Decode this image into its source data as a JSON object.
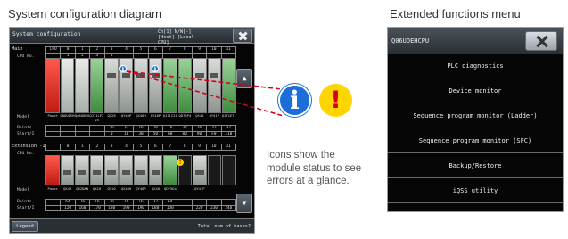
{
  "captions": {
    "system_config": "System configuration diagram",
    "extended_menu": "Extended functions menu"
  },
  "system_config_screen": {
    "title": "System configuration",
    "cpu_info": {
      "line1": "Ch[1] N/W[-]",
      "line2": "[Host] [Local CPU]"
    },
    "main": {
      "label": "Main",
      "row_labels": {
        "cpu_no": "CPU No.",
        "model": "Model",
        "points": "Points",
        "start": "Start/I"
      },
      "slot_numbers": [
        "CPU",
        "0",
        "1",
        "2",
        "3",
        "4",
        "5",
        "6",
        "7",
        "8",
        "9",
        "10",
        "11"
      ],
      "cpu_numbers": [
        "",
        "1",
        "2",
        "3",
        "4",
        "",
        "",
        "",
        "",
        "",
        "",
        "",
        ""
      ],
      "models": [
        "Power",
        "Q06UDEHCPU",
        "Q06UDEHCPU",
        "QJ71LP21-25",
        "QX28",
        "QY40P",
        "QX40H",
        "QY40P",
        "QJ71C24N",
        "QD75P4",
        "QX41",
        "QY41P",
        "QJ71E71"
      ],
      "points": [
        "",
        "",
        "",
        "",
        "16",
        "32",
        "16",
        "16",
        "16",
        "32",
        "16",
        "32",
        "32"
      ],
      "start": [
        "",
        "",
        "",
        "",
        "0",
        "10",
        "30",
        "50",
        "60",
        "80",
        "90",
        "F0",
        "110"
      ]
    },
    "extension": {
      "label": "Extension -1",
      "slot_numbers": [
        "",
        "0",
        "1",
        "2",
        "3",
        "4",
        "5",
        "6",
        "7",
        "8",
        "9",
        "10",
        "11"
      ],
      "models": [
        "Power",
        "QX42",
        "Q62DAN",
        "QX10",
        "QY10",
        "QX40H",
        "QY40P",
        "QX40",
        "QD75D4",
        "",
        "QY41P",
        "",
        ""
      ],
      "points": [
        "",
        "64",
        "16",
        "16",
        "16",
        "16",
        "16",
        "32",
        "64",
        "",
        "",
        "",
        ""
      ],
      "start": [
        "",
        "120",
        "160",
        "170",
        "180",
        "190",
        "1A0",
        "1B0",
        "1D0",
        "",
        "220",
        "230",
        "240"
      ]
    },
    "legend_button": "Legend",
    "bases_label": "Total num of bases2",
    "scroll_up": "▲",
    "scroll_down": "▼",
    "status_badges": [
      {
        "symbol": "i",
        "color": "#1c6dd8",
        "icon": "info-icon"
      },
      {
        "symbol": "!",
        "color": "#ffd500",
        "icon": "warning-icon"
      }
    ]
  },
  "callout": {
    "info_symbol": "i",
    "warning_symbol": "!",
    "info_color": "#1c6dd8",
    "warning_color": "#ffd500",
    "line_color": "#d6001c",
    "text": "Icons show the module status to see errors at a glance."
  },
  "extended_menu_screen": {
    "title": "Q06UDEHCPU",
    "items": [
      "PLC diagnostics",
      "Device monitor",
      "Sequence program monitor (Ladder)",
      "Sequence program monitor (SFC)",
      "Backup/Restore",
      "iQSS utility"
    ]
  }
}
